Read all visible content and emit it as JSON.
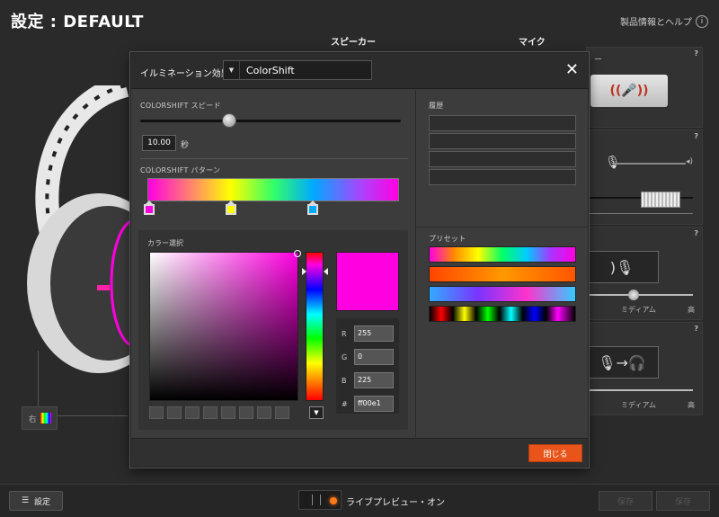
{
  "app": {
    "title": "設定 : DEFAULT",
    "help_label": "製品情報とヘルプ",
    "tab_speaker": "スピーカー",
    "tab_mic": "マイク"
  },
  "right_panels": {
    "p1_label": "ー",
    "q": "?",
    "med1": "ミディアム",
    "high1": "高",
    "med2": "ミディアム",
    "high2": "高",
    "right_channel": "右"
  },
  "bottom": {
    "settings_label": "設定",
    "live_label": "ライブプレビュー・オン",
    "btn_a": "保存",
    "btn_b": "保存"
  },
  "dialog": {
    "effect_label": "イルミネーション効果",
    "effect_value": "ColorShift",
    "close_x": "✕",
    "speed_label": "COLORSHIFT スピード",
    "speed_value": "10.00",
    "speed_unit": "秒",
    "pattern_label": "COLORSHIFT パターン",
    "color_select_label": "カラー選択",
    "rgb": {
      "r_label": "R",
      "r": "255",
      "g_label": "G",
      "g": "0",
      "b_label": "B",
      "b": "225",
      "hex_label": "#",
      "hex": "ff00e1"
    },
    "history_label": "履歴",
    "preset_label": "プリセット",
    "close_button": "閉じる"
  },
  "colors": {
    "selected": "#ff00e1",
    "accent": "#e8541a",
    "stop1": "#ff00e1",
    "stop2": "#ffff00",
    "stop3": "#00aaff"
  }
}
